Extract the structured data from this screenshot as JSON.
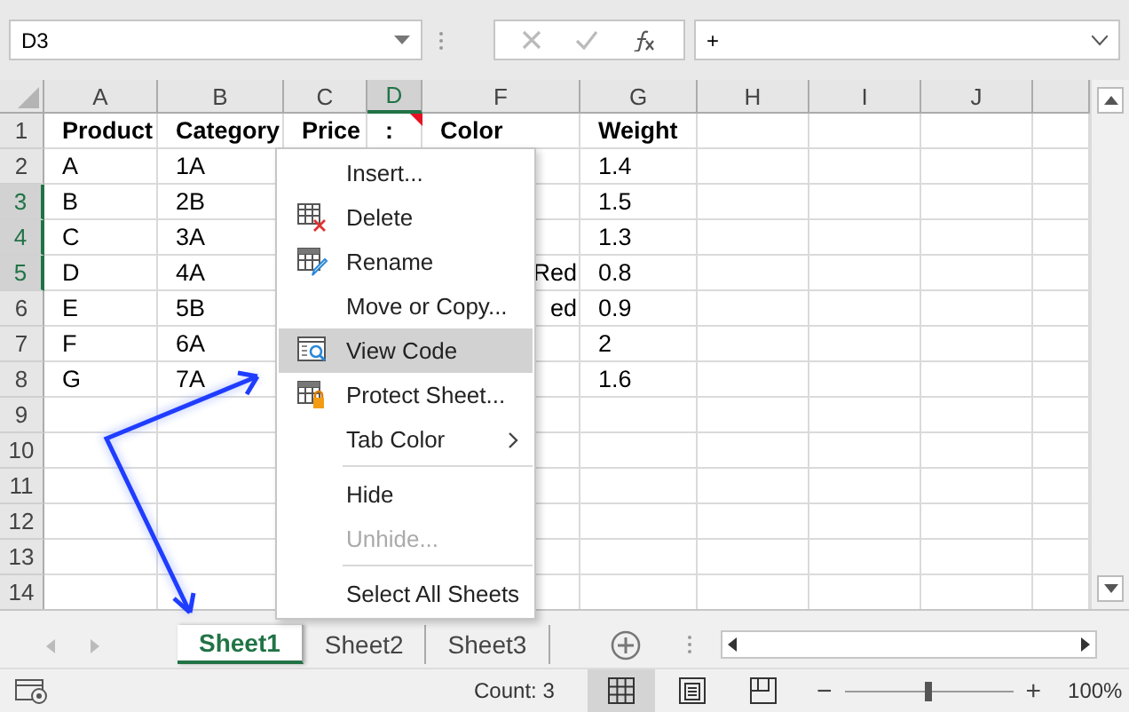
{
  "name_box": {
    "value": "D3"
  },
  "formula_bar": {
    "value": "+"
  },
  "columns": [
    {
      "label": "A",
      "selected": false
    },
    {
      "label": "B",
      "selected": false
    },
    {
      "label": "C",
      "selected": false
    },
    {
      "label": "D",
      "selected": true
    },
    {
      "label": "F",
      "selected": false
    },
    {
      "label": "G",
      "selected": false
    },
    {
      "label": "H",
      "selected": false
    },
    {
      "label": "I",
      "selected": false
    },
    {
      "label": "J",
      "selected": false
    }
  ],
  "rows": [
    {
      "header": "1",
      "selected": false,
      "kind": "header",
      "cells": [
        {
          "text": "Product"
        },
        {
          "text": "Category"
        },
        {
          "text": "Price"
        },
        {
          "text": ":",
          "comment": true
        },
        {
          "text": "Color"
        },
        {
          "text": "Weight"
        },
        null,
        null,
        null
      ]
    },
    {
      "header": "2",
      "selected": false,
      "kind": "data",
      "cells": [
        {
          "text": "A"
        },
        {
          "text": "1A"
        },
        null,
        null,
        null,
        {
          "text": "1.4"
        },
        null,
        null,
        null
      ]
    },
    {
      "header": "3",
      "selected": true,
      "kind": "data",
      "cells": [
        {
          "text": "B"
        },
        {
          "text": "2B"
        },
        null,
        null,
        null,
        {
          "text": "1.5"
        },
        null,
        null,
        null
      ]
    },
    {
      "header": "4",
      "selected": true,
      "kind": "data",
      "cells": [
        {
          "text": "C"
        },
        {
          "text": "3A"
        },
        null,
        null,
        null,
        {
          "text": "1.3"
        },
        null,
        null,
        null
      ]
    },
    {
      "header": "5",
      "selected": true,
      "kind": "data",
      "cells": [
        {
          "text": "D"
        },
        {
          "text": "4A"
        },
        null,
        null,
        {
          "text": "Red",
          "clipped": true
        },
        {
          "text": "0.8"
        },
        null,
        null,
        null
      ]
    },
    {
      "header": "6",
      "selected": false,
      "kind": "data",
      "cells": [
        {
          "text": "E"
        },
        {
          "text": "5B"
        },
        null,
        null,
        {
          "text": "ed",
          "clipped": true
        },
        {
          "text": "0.9"
        },
        null,
        null,
        null
      ]
    },
    {
      "header": "7",
      "selected": false,
      "kind": "data",
      "cells": [
        {
          "text": "F"
        },
        {
          "text": "6A"
        },
        null,
        null,
        null,
        {
          "text": "2"
        },
        null,
        null,
        null
      ]
    },
    {
      "header": "8",
      "selected": false,
      "kind": "data",
      "cells": [
        {
          "text": "G"
        },
        {
          "text": "7A"
        },
        null,
        null,
        null,
        {
          "text": "1.6"
        },
        null,
        null,
        null
      ]
    },
    {
      "header": "9",
      "selected": false,
      "kind": "data",
      "cells": []
    },
    {
      "header": "10",
      "selected": false,
      "kind": "data",
      "cells": []
    },
    {
      "header": "11",
      "selected": false,
      "kind": "data",
      "cells": []
    },
    {
      "header": "12",
      "selected": false,
      "kind": "data",
      "cells": []
    },
    {
      "header": "13",
      "selected": false,
      "kind": "data",
      "cells": []
    },
    {
      "header": "14",
      "selected": false,
      "kind": "data",
      "cells": []
    }
  ],
  "context_menu": [
    {
      "kind": "item",
      "label": "Insert...",
      "selected": false,
      "disabled": false
    },
    {
      "kind": "item",
      "label": "Delete",
      "selected": false,
      "disabled": false
    },
    {
      "kind": "item",
      "label": "Rename",
      "selected": false,
      "disabled": false
    },
    {
      "kind": "item",
      "label": "Move or Copy...",
      "selected": false,
      "disabled": false
    },
    {
      "kind": "item",
      "label": "View Code",
      "selected": true,
      "disabled": false
    },
    {
      "kind": "item",
      "label": "Protect Sheet...",
      "selected": false,
      "disabled": false
    },
    {
      "kind": "submenu",
      "label": "Tab Color",
      "selected": false,
      "disabled": false
    },
    {
      "kind": "separator"
    },
    {
      "kind": "item",
      "label": "Hide",
      "selected": false,
      "disabled": false
    },
    {
      "kind": "item",
      "label": "Unhide...",
      "selected": false,
      "disabled": true
    },
    {
      "kind": "separator"
    },
    {
      "kind": "item",
      "label": "Select All Sheets",
      "selected": false,
      "disabled": false
    }
  ],
  "sheet_tabs": [
    {
      "label": "Sheet1",
      "selected": true
    },
    {
      "label": "Sheet2",
      "selected": false
    },
    {
      "label": "Sheet3",
      "selected": false
    }
  ],
  "status_bar": {
    "count": "Count: 3",
    "views": [
      {
        "kind": "normal",
        "selected": true
      },
      {
        "kind": "page-layout",
        "selected": false
      },
      {
        "kind": "page-break",
        "selected": false
      }
    ],
    "zoom": {
      "minus": "−",
      "plus": "+",
      "level": 0.5,
      "reading": "100%"
    }
  }
}
